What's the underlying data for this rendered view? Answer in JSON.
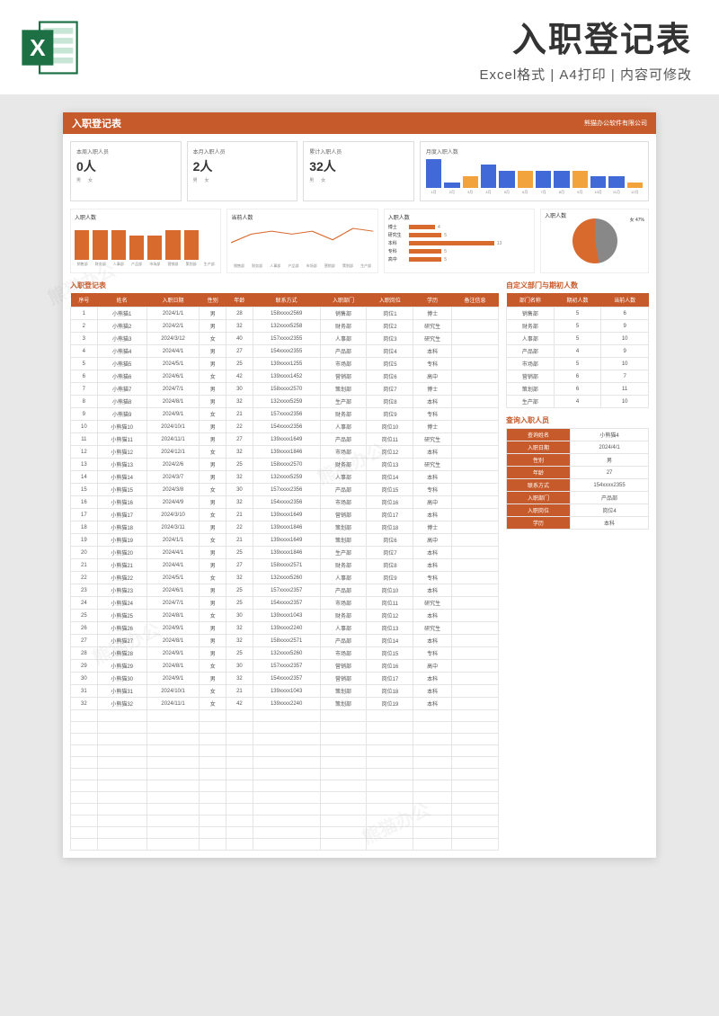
{
  "top": {
    "title": "入职登记表",
    "subtitle": "Excel格式 | A4打印 | 内容可修改"
  },
  "header": {
    "title": "入职登记表",
    "company": "熊猫办公软件有限公司"
  },
  "stats": {
    "week": {
      "label": "本周入职人员",
      "value": "0人",
      "m": "男",
      "f": "女"
    },
    "month": {
      "label": "本月入职人员",
      "value": "2人",
      "m": "男",
      "f": "女"
    },
    "total": {
      "label": "累计入职人员",
      "value": "32人",
      "m": "男",
      "f": "女"
    }
  },
  "monthly_title": "月度入职人数",
  "chart_data": {
    "monthly": {
      "type": "bar",
      "categories": [
        "1月",
        "2月",
        "3月",
        "4月",
        "5月",
        "6月",
        "7月",
        "8月",
        "9月",
        "10月",
        "11月",
        "12月"
      ],
      "values": [
        5,
        1,
        2,
        4,
        3,
        3,
        3,
        3,
        3,
        2,
        2,
        1
      ]
    },
    "dept_count": {
      "type": "bar",
      "title": "入职人数",
      "categories": [
        "销售部",
        "财务部",
        "人事部",
        "产品部",
        "市场部",
        "营销部",
        "策划部",
        "生产部"
      ],
      "values": [
        5,
        5,
        5,
        4,
        4,
        5,
        5,
        0
      ],
      "ylim": [
        0,
        6
      ]
    },
    "dept_current": {
      "type": "line",
      "title": "当前人数",
      "categories": [
        "销售部",
        "财务部",
        "人事部",
        "产品部",
        "市场部",
        "营销部",
        "策划部",
        "生产部"
      ],
      "values": [
        6,
        9,
        10,
        9,
        10,
        7,
        11,
        10
      ]
    },
    "edu": {
      "type": "bar",
      "title": "入职人数",
      "categories": [
        "博士",
        "研究生",
        "本科",
        "专科",
        "高中"
      ],
      "values": [
        4,
        5,
        13,
        5,
        5
      ]
    },
    "gender": {
      "type": "pie",
      "title": "入职人数",
      "series": [
        {
          "name": "男",
          "value": 53
        },
        {
          "name": "女",
          "value": 47
        }
      ]
    }
  },
  "table_title": "入职登记表",
  "columns": [
    "序号",
    "姓名",
    "入职日期",
    "性别",
    "年龄",
    "联系方式",
    "入职部门",
    "入职岗位",
    "学历",
    "备注信息"
  ],
  "rows": [
    [
      "1",
      "小熊猫1",
      "2024/1/1",
      "男",
      "28",
      "158xxxx2569",
      "销售部",
      "岗位1",
      "博士",
      ""
    ],
    [
      "2",
      "小熊猫2",
      "2024/2/1",
      "男",
      "32",
      "132xxxx5258",
      "财务部",
      "岗位2",
      "研究生",
      ""
    ],
    [
      "3",
      "小熊猫3",
      "2024/3/12",
      "女",
      "40",
      "157xxxx2355",
      "人事部",
      "岗位3",
      "研究生",
      ""
    ],
    [
      "4",
      "小熊猫4",
      "2024/4/1",
      "男",
      "27",
      "154xxxx2355",
      "产品部",
      "岗位4",
      "本科",
      ""
    ],
    [
      "5",
      "小熊猫5",
      "2024/5/1",
      "男",
      "25",
      "139xxxx1255",
      "市场部",
      "岗位5",
      "专科",
      ""
    ],
    [
      "6",
      "小熊猫6",
      "2024/6/1",
      "女",
      "42",
      "139xxxx1452",
      "营销部",
      "岗位6",
      "高中",
      ""
    ],
    [
      "7",
      "小熊猫7",
      "2024/7/1",
      "男",
      "30",
      "158xxxx2570",
      "策划部",
      "岗位7",
      "博士",
      ""
    ],
    [
      "8",
      "小熊猫8",
      "2024/8/1",
      "男",
      "32",
      "132xxxx5259",
      "生产部",
      "岗位8",
      "本科",
      ""
    ],
    [
      "9",
      "小熊猫9",
      "2024/9/1",
      "女",
      "21",
      "157xxxx2356",
      "财务部",
      "岗位9",
      "专科",
      ""
    ],
    [
      "10",
      "小熊猫10",
      "2024/10/1",
      "男",
      "22",
      "154xxxx2356",
      "人事部",
      "岗位10",
      "博士",
      ""
    ],
    [
      "11",
      "小熊猫11",
      "2024/11/1",
      "男",
      "27",
      "139xxxx1649",
      "产品部",
      "岗位11",
      "研究生",
      ""
    ],
    [
      "12",
      "小熊猫12",
      "2024/12/1",
      "女",
      "32",
      "139xxxx1846",
      "市场部",
      "岗位12",
      "本科",
      ""
    ],
    [
      "13",
      "小熊猫13",
      "2024/2/6",
      "男",
      "25",
      "158xxxx2570",
      "财务部",
      "岗位13",
      "研究生",
      ""
    ],
    [
      "14",
      "小熊猫14",
      "2024/3/7",
      "男",
      "32",
      "132xxxx5259",
      "人事部",
      "岗位14",
      "本科",
      ""
    ],
    [
      "15",
      "小熊猫15",
      "2024/3/8",
      "女",
      "30",
      "157xxxx2356",
      "产品部",
      "岗位15",
      "专科",
      ""
    ],
    [
      "16",
      "小熊猫16",
      "2024/4/9",
      "男",
      "32",
      "154xxxx2356",
      "市场部",
      "岗位16",
      "高中",
      ""
    ],
    [
      "17",
      "小熊猫17",
      "2024/3/10",
      "女",
      "21",
      "139xxxx1649",
      "营销部",
      "岗位17",
      "本科",
      ""
    ],
    [
      "18",
      "小熊猫18",
      "2024/3/11",
      "男",
      "22",
      "139xxxx1846",
      "策划部",
      "岗位18",
      "博士",
      ""
    ],
    [
      "19",
      "小熊猫19",
      "2024/1/1",
      "女",
      "21",
      "139xxxx1649",
      "策划部",
      "岗位6",
      "高中",
      ""
    ],
    [
      "20",
      "小熊猫20",
      "2024/4/1",
      "男",
      "25",
      "139xxxx1846",
      "生产部",
      "岗位7",
      "本科",
      ""
    ],
    [
      "21",
      "小熊猫21",
      "2024/4/1",
      "男",
      "27",
      "158xxxx2571",
      "财务部",
      "岗位8",
      "本科",
      ""
    ],
    [
      "22",
      "小熊猫22",
      "2024/5/1",
      "女",
      "32",
      "132xxxx5260",
      "人事部",
      "岗位9",
      "专科",
      ""
    ],
    [
      "23",
      "小熊猫23",
      "2024/6/1",
      "男",
      "25",
      "157xxxx2357",
      "产品部",
      "岗位10",
      "本科",
      ""
    ],
    [
      "24",
      "小熊猫24",
      "2024/7/1",
      "男",
      "25",
      "154xxxx2357",
      "市场部",
      "岗位11",
      "研究生",
      ""
    ],
    [
      "25",
      "小熊猫25",
      "2024/8/1",
      "女",
      "30",
      "139xxxx1043",
      "财务部",
      "岗位12",
      "本科",
      ""
    ],
    [
      "26",
      "小熊猫26",
      "2024/9/1",
      "男",
      "32",
      "139xxxx2240",
      "人事部",
      "岗位13",
      "研究生",
      ""
    ],
    [
      "27",
      "小熊猫27",
      "2024/8/1",
      "男",
      "32",
      "158xxxx2571",
      "产品部",
      "岗位14",
      "本科",
      ""
    ],
    [
      "28",
      "小熊猫28",
      "2024/9/1",
      "男",
      "25",
      "132xxxx5260",
      "市场部",
      "岗位15",
      "专科",
      ""
    ],
    [
      "29",
      "小熊猫29",
      "2024/8/1",
      "女",
      "30",
      "157xxxx2357",
      "营销部",
      "岗位16",
      "高中",
      ""
    ],
    [
      "30",
      "小熊猫30",
      "2024/9/1",
      "男",
      "32",
      "154xxxx2357",
      "营销部",
      "岗位17",
      "本科",
      ""
    ],
    [
      "31",
      "小熊猫31",
      "2024/10/1",
      "女",
      "21",
      "139xxxx1043",
      "策划部",
      "岗位18",
      "本科",
      ""
    ],
    [
      "32",
      "小熊猫32",
      "2024/11/1",
      "女",
      "42",
      "139xxxx2240",
      "策划部",
      "岗位19",
      "本科",
      ""
    ]
  ],
  "dept_title": "自定义部门与期初人数",
  "dept_cols": [
    "部门名称",
    "期初人数",
    "当前人数"
  ],
  "dept_rows": [
    [
      "销售部",
      "5",
      "6"
    ],
    [
      "财务部",
      "5",
      "9"
    ],
    [
      "人事部",
      "5",
      "10"
    ],
    [
      "产品部",
      "4",
      "9"
    ],
    [
      "市场部",
      "5",
      "10"
    ],
    [
      "营销部",
      "6",
      "7"
    ],
    [
      "策划部",
      "6",
      "11"
    ],
    [
      "生产部",
      "4",
      "10"
    ]
  ],
  "query_title": "查询入职人员",
  "query": [
    [
      "查询姓名",
      "小熊猫4"
    ],
    [
      "入职日期",
      "2024/4/1"
    ],
    [
      "性别",
      "男"
    ],
    [
      "年龄",
      "27"
    ],
    [
      "联系方式",
      "154xxxx2355"
    ],
    [
      "入职部门",
      "产品部"
    ],
    [
      "入职岗位",
      "岗位4"
    ],
    [
      "学历",
      "本科"
    ]
  ],
  "watermark": "熊猫办公"
}
